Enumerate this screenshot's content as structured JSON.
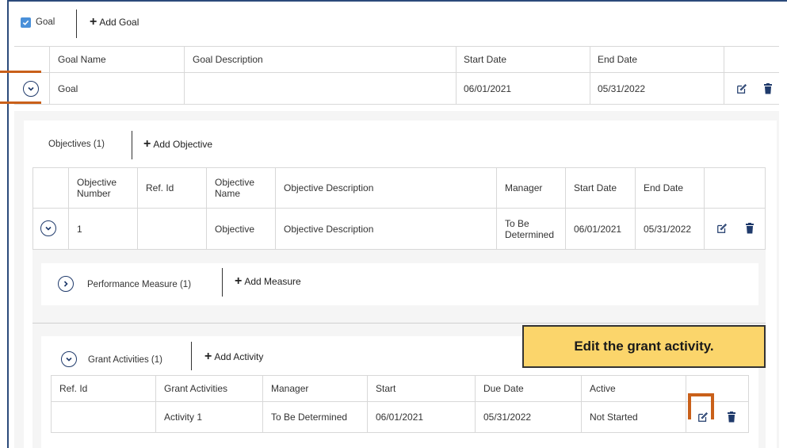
{
  "goal_section": {
    "tab_label": "Goal",
    "add_label": "Add Goal",
    "columns": [
      "Goal Name",
      "Goal Description",
      "Start Date",
      "End Date"
    ],
    "row": {
      "name": "Goal",
      "description": "",
      "start": "06/01/2021",
      "end": "05/31/2022"
    }
  },
  "objectives": {
    "tab_label": "Objectives (1)",
    "add_label": "Add Objective",
    "columns": [
      "Objective\nNumber",
      "Ref. Id",
      "Objective\nName",
      "Objective Description",
      "Manager",
      "Start Date",
      "End Date"
    ],
    "row": {
      "number": "1",
      "ref_id": "",
      "name": "Objective",
      "description": "Objective Description",
      "manager": "To Be\nDetermined",
      "start": "06/01/2021",
      "end": "05/31/2022"
    }
  },
  "performance_measure": {
    "label": "Performance Measure (1)",
    "add_label": "Add Measure"
  },
  "grant_activities": {
    "label": "Grant Activities (1)",
    "add_label": "Add Activity",
    "columns": [
      "Ref. Id",
      "Grant Activities",
      "Manager",
      "Start",
      "Due Date",
      "Active"
    ],
    "row": {
      "ref_id": "",
      "activity": "Activity 1",
      "manager": "To Be Determined",
      "start": "06/01/2021",
      "due": "05/31/2022",
      "active": "Not Started"
    }
  },
  "callout": {
    "text": "Edit the grant activity."
  },
  "colors": {
    "accent": "#4a90d9",
    "callout_bg": "#fbd56b",
    "highlight": "#c9601a",
    "icon": "#1f3a6b"
  }
}
